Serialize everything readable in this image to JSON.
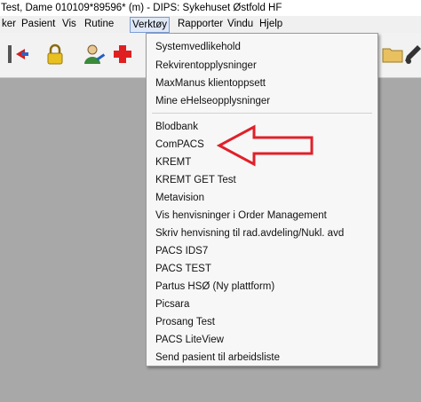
{
  "window": {
    "title": "Test, Dame 010109*89596* (m) - DIPS: Sykehuset Østfold HF"
  },
  "menubar": {
    "items": [
      "ker",
      "Pasient",
      "Vis",
      "Rutine",
      "Verktøy",
      "Rapporter",
      "Vindu",
      "Hjelp"
    ],
    "active": "Verktøy"
  },
  "toolbar": {
    "icons": [
      "swap-arrow-icon",
      "lock-icon",
      "user-edit-icon",
      "red-cross-icon",
      "folder-icon",
      "pen-icon"
    ]
  },
  "dropdown": {
    "group1": [
      "Systemvedlikehold",
      "Rekvirentopplysninger",
      "MaxManus klientoppsett",
      "Mine eHelseopplysninger"
    ],
    "group2": [
      "Blodbank",
      "ComPACS",
      "KREMT",
      "KREMT GET Test",
      "Metavision",
      "Vis henvisninger i Order Management",
      "Skriv henvisning til rad.avdeling/Nukl. avd",
      "PACS IDS7",
      "PACS TEST",
      "Partus HSØ (Ny plattform)",
      "Picsara",
      "Prosang Test",
      "PACS LiteView",
      "Send pasient til arbeidsliste"
    ]
  },
  "annotation": {
    "arrow_color": "#e0202a",
    "points_to": "ComPACS"
  }
}
